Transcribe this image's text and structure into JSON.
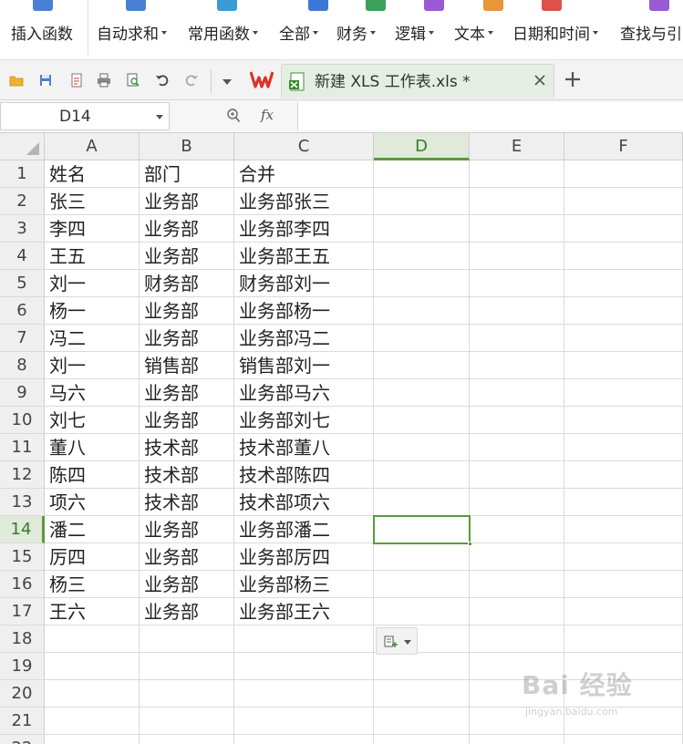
{
  "ribbon": {
    "items": [
      {
        "label": "插入函数",
        "caret": false,
        "icon": "fx-icon",
        "color": "#4a7fd6"
      },
      {
        "label": "自动求和",
        "caret": true,
        "icon": "sigma-icon",
        "color": "#4a7fd6"
      },
      {
        "label": "常用函数",
        "caret": true,
        "icon": "star-icon",
        "color": "#3a9ad6"
      },
      {
        "label": "全部",
        "caret": true,
        "icon": "list-icon",
        "color": "#3a78d6"
      },
      {
        "label": "财务",
        "caret": true,
        "icon": "calculator-icon",
        "color": "#3aa05a"
      },
      {
        "label": "逻辑",
        "caret": true,
        "icon": "logic-icon",
        "color": "#9a5ad6"
      },
      {
        "label": "文本",
        "caret": true,
        "icon": "text-icon",
        "color": "#e8963a"
      },
      {
        "label": "日期和时间",
        "caret": true,
        "icon": "clock-icon",
        "color": "#e0504a"
      },
      {
        "label": "查找与引",
        "caret": false,
        "icon": "lookup-icon",
        "color": "#9a5ad6"
      }
    ]
  },
  "tabbar": {
    "tab_title": "新建 XLS 工作表.xls *",
    "wps_logo": "W"
  },
  "formula_bar": {
    "name_box": "D14",
    "fx_label": "fx",
    "formula": ""
  },
  "sheet": {
    "columns": [
      "A",
      "B",
      "C",
      "D",
      "E",
      "F"
    ],
    "active_column": "D",
    "active_row": "14",
    "rows": [
      {
        "num": "1",
        "cells": [
          "姓名",
          "部门",
          "合并"
        ]
      },
      {
        "num": "2",
        "cells": [
          "张三",
          "业务部",
          "业务部张三"
        ]
      },
      {
        "num": "3",
        "cells": [
          "李四",
          "业务部",
          "业务部李四"
        ]
      },
      {
        "num": "4",
        "cells": [
          "王五",
          "业务部",
          "业务部王五"
        ]
      },
      {
        "num": "5",
        "cells": [
          "刘一",
          "财务部",
          "财务部刘一"
        ]
      },
      {
        "num": "6",
        "cells": [
          "杨一",
          "业务部",
          "业务部杨一"
        ]
      },
      {
        "num": "7",
        "cells": [
          "冯二",
          "业务部",
          "业务部冯二"
        ]
      },
      {
        "num": "8",
        "cells": [
          "刘一",
          "销售部",
          "销售部刘一"
        ]
      },
      {
        "num": "9",
        "cells": [
          "马六",
          "业务部",
          "业务部马六"
        ]
      },
      {
        "num": "10",
        "cells": [
          "刘七",
          "业务部",
          "业务部刘七"
        ]
      },
      {
        "num": "11",
        "cells": [
          "董八",
          "技术部",
          "技术部董八"
        ]
      },
      {
        "num": "12",
        "cells": [
          "陈四",
          "技术部",
          "技术部陈四"
        ]
      },
      {
        "num": "13",
        "cells": [
          "项六",
          "技术部",
          "技术部项六"
        ]
      },
      {
        "num": "14",
        "cells": [
          "潘二",
          "业务部",
          "业务部潘二"
        ]
      },
      {
        "num": "15",
        "cells": [
          "厉四",
          "业务部",
          "业务部厉四"
        ]
      },
      {
        "num": "16",
        "cells": [
          "杨三",
          "业务部",
          "业务部杨三"
        ]
      },
      {
        "num": "17",
        "cells": [
          "王六",
          "业务部",
          "业务部王六"
        ]
      },
      {
        "num": "18",
        "cells": [
          "",
          "",
          ""
        ]
      },
      {
        "num": "19",
        "cells": [
          "",
          "",
          ""
        ]
      },
      {
        "num": "20",
        "cells": [
          "",
          "",
          ""
        ]
      },
      {
        "num": "21",
        "cells": [
          "",
          "",
          ""
        ]
      },
      {
        "num": "22",
        "cells": [
          "",
          "",
          ""
        ]
      }
    ]
  },
  "colors": {
    "accent_green": "#5a9a3a",
    "tab_bg": "#e5eee3",
    "header_bg": "#efefef",
    "wps_red": "#d9362b"
  },
  "watermark": {
    "logo": "Bai 经验",
    "url": "jingyan.baidu.com"
  }
}
